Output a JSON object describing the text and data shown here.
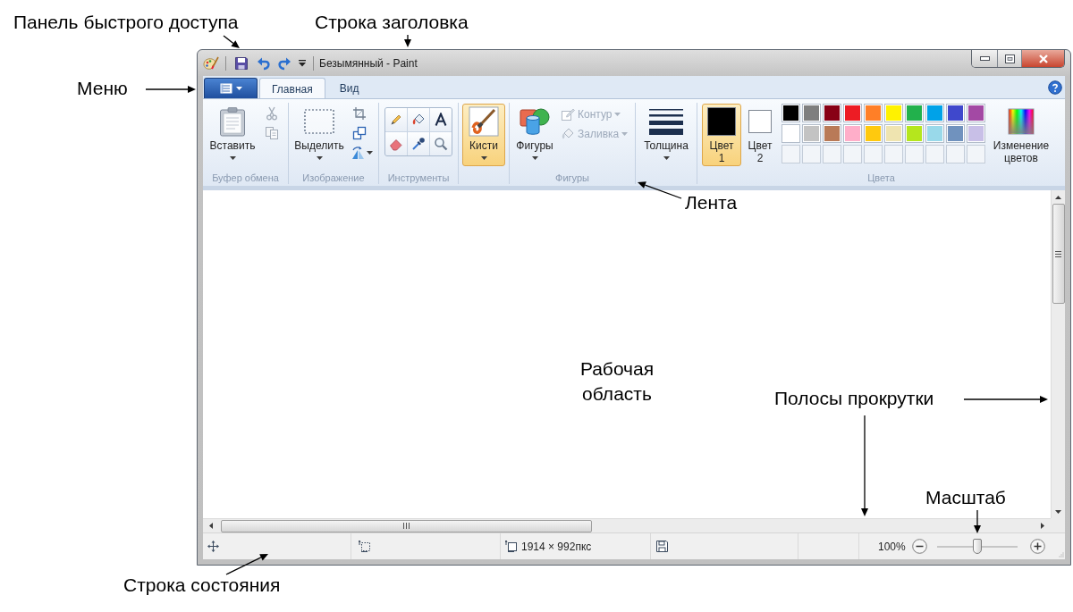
{
  "annotations": [
    {
      "text": "Панель быстрого доступа"
    },
    {
      "text": "Строка заголовка"
    },
    {
      "text": "Меню"
    },
    {
      "text": "Лента"
    },
    {
      "text": "Рабочая область"
    },
    {
      "text": "Полосы прокрутки"
    },
    {
      "text": "Масштаб"
    },
    {
      "text": "Строка состояния"
    }
  ],
  "window": {
    "title": "Безымянный - Paint"
  },
  "tabs": [
    {
      "label": "Главная",
      "selected": true
    },
    {
      "label": "Вид",
      "selected": false
    }
  ],
  "ribbon": {
    "groups": [
      {
        "kind": "clipboard",
        "label": "Буфер обмена",
        "button": {
          "label": "Вставить"
        },
        "tools": [
          {
            "disabled": true
          },
          {
            "disabled": true
          }
        ]
      },
      {
        "kind": "image",
        "label": "Изображение",
        "button": {
          "label": "Выделить"
        }
      },
      {
        "kind": "tools",
        "label": "Инструменты"
      },
      {
        "kind": "brushes",
        "button": {
          "label": "Кисти",
          "selected": true
        }
      },
      {
        "kind": "shapes",
        "label": "Фигуры",
        "button": {
          "label": "Фигуры",
          "selected": false
        },
        "options": [
          {
            "label": "Контур",
            "disabled": true
          },
          {
            "label": "Заливка",
            "disabled": true
          }
        ]
      },
      {
        "kind": "size",
        "button": {
          "label": "Толщина"
        }
      },
      {
        "kind": "colors",
        "label": "Цвета",
        "slots": [
          {
            "label": "Цвет 1",
            "selected": true,
            "color": "#000000"
          },
          {
            "label": "Цвет 2",
            "selected": false,
            "color": "#ffffff"
          }
        ],
        "palette": [
          {
            "kind": "swatch",
            "color": "#000000"
          },
          {
            "kind": "swatch",
            "color": "#7f7f7f"
          },
          {
            "kind": "swatch",
            "color": "#880015"
          },
          {
            "kind": "swatch",
            "color": "#ed1c24"
          },
          {
            "kind": "swatch",
            "color": "#ff7f27"
          },
          {
            "kind": "swatch",
            "color": "#fff200"
          },
          {
            "kind": "swatch",
            "color": "#22b14c"
          },
          {
            "kind": "swatch",
            "color": "#00a2e8"
          },
          {
            "kind": "swatch",
            "color": "#3f48cc"
          },
          {
            "kind": "swatch",
            "color": "#a349a4"
          },
          {
            "kind": "swatch",
            "color": "#ffffff"
          },
          {
            "kind": "swatch",
            "color": "#c3c3c3"
          },
          {
            "kind": "swatch",
            "color": "#b97a57"
          },
          {
            "kind": "swatch",
            "color": "#ffaec9"
          },
          {
            "kind": "swatch",
            "color": "#ffc90e"
          },
          {
            "kind": "swatch",
            "color": "#efe4b0"
          },
          {
            "kind": "swatch",
            "color": "#b5e61d"
          },
          {
            "kind": "swatch",
            "color": "#99d9ea"
          },
          {
            "kind": "swatch",
            "color": "#7092be"
          },
          {
            "kind": "swatch",
            "color": "#c8bfe7"
          },
          {
            "kind": "empty"
          },
          {
            "kind": "empty"
          },
          {
            "kind": "empty"
          },
          {
            "kind": "empty"
          },
          {
            "kind": "empty"
          },
          {
            "kind": "empty"
          },
          {
            "kind": "empty"
          },
          {
            "kind": "empty"
          },
          {
            "kind": "empty"
          },
          {
            "kind": "empty"
          }
        ],
        "button": {
          "label": "Изменение цветов"
        }
      }
    ]
  },
  "status_bar": {
    "canvas_size": "1914 × 992пкс",
    "zoom": {
      "reading": "100%",
      "level": 0.5
    }
  }
}
